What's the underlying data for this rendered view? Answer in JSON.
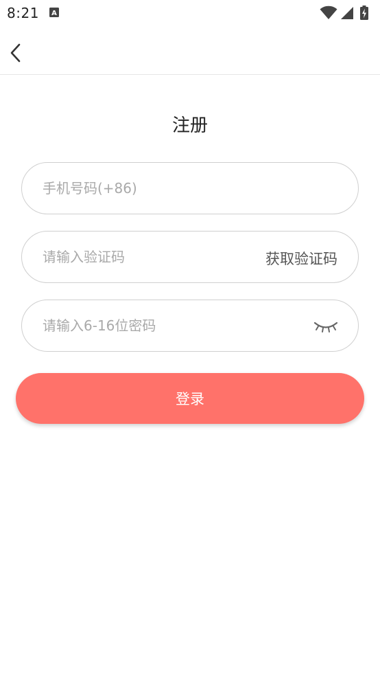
{
  "status_bar": {
    "time": "8:21",
    "app_icon_letter": "A",
    "icons": [
      "wifi-icon",
      "cellular-signal-icon",
      "battery-charging-icon"
    ]
  },
  "app_bar": {
    "back_icon": "chevron-left-icon"
  },
  "page": {
    "title": "注册"
  },
  "form": {
    "phone_placeholder": "手机号码(+86)",
    "phone_value": "",
    "code_placeholder": "请输入验证码",
    "code_value": "",
    "get_code_label": "获取验证码",
    "password_placeholder": "请输入6-16位密码",
    "password_value": "",
    "password_toggle_icon": "eye-closed-icon",
    "submit_label": "登录"
  },
  "colors": {
    "accent": "#ff726a",
    "border": "#cfcfcf",
    "placeholder": "#a9a9a9"
  }
}
